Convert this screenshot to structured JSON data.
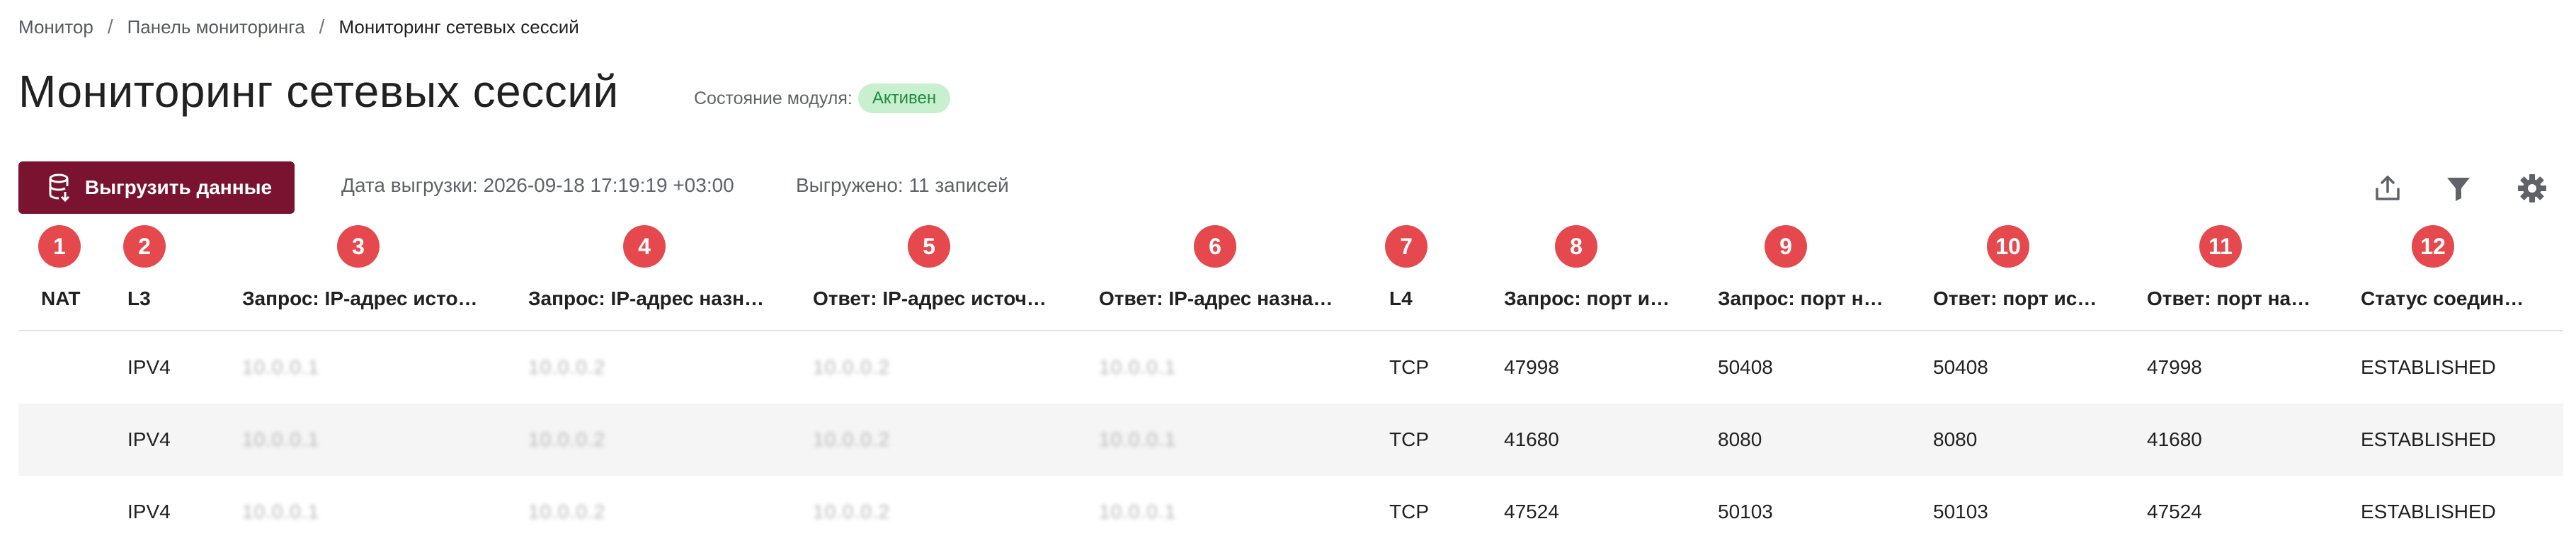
{
  "breadcrumb": {
    "items": [
      "Монитор",
      "Панель мониторинга"
    ],
    "current": "Мониторинг сетевых сессий"
  },
  "page": {
    "title": "Мониторинг сетевых сессий",
    "module_state_label": "Состояние модуля:",
    "module_state_value": "Активен"
  },
  "toolbar": {
    "export_label": "Выгрузить данные",
    "export_date": "Дата выгрузки: 2026-09-18 17:19:19 +03:00",
    "export_count": "Выгружено: 11 записей",
    "icons": [
      "upload-icon",
      "filter-icon",
      "gear-icon"
    ]
  },
  "colors": {
    "accent": "#7a1330",
    "badge_bg": "#c8f0cf",
    "badge_text": "#1f8b3a",
    "marker": "#e5484d",
    "row_alt": "#f5f5f5"
  },
  "table": {
    "columns": [
      {
        "n": "1",
        "label": "NAT"
      },
      {
        "n": "2",
        "label": "L3"
      },
      {
        "n": "3",
        "label": "Запрос: IP-адрес исто…"
      },
      {
        "n": "4",
        "label": "Запрос: IP-адрес назн…"
      },
      {
        "n": "5",
        "label": "Ответ: IP-адрес источ…"
      },
      {
        "n": "6",
        "label": "Ответ: IP-адрес назна…"
      },
      {
        "n": "7",
        "label": "L4"
      },
      {
        "n": "8",
        "label": "Запрос: порт и…"
      },
      {
        "n": "9",
        "label": "Запрос: порт н…"
      },
      {
        "n": "10",
        "label": "Ответ: порт ис…"
      },
      {
        "n": "11",
        "label": "Ответ: порт на…"
      },
      {
        "n": "12",
        "label": "Статус соедин…"
      }
    ],
    "rows": [
      [
        "",
        "IPV4",
        "10.0.0.1",
        "10.0.0.2",
        "10.0.0.2",
        "10.0.0.1",
        "TCP",
        "47998",
        "50408",
        "50408",
        "47998",
        "ESTABLISHED"
      ],
      [
        "",
        "IPV4",
        "10.0.0.1",
        "10.0.0.2",
        "10.0.0.2",
        "10.0.0.1",
        "TCP",
        "41680",
        "8080",
        "8080",
        "41680",
        "ESTABLISHED"
      ],
      [
        "",
        "IPV4",
        "10.0.0.1",
        "10.0.0.2",
        "10.0.0.2",
        "10.0.0.1",
        "TCP",
        "47524",
        "50103",
        "50103",
        "47524",
        "ESTABLISHED"
      ]
    ]
  }
}
